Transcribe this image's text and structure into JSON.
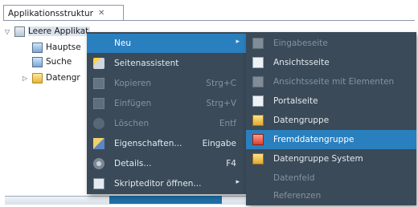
{
  "view": {
    "tab_label": "Applikationsstruktur",
    "tab_close": "✕"
  },
  "tree": {
    "items": [
      {
        "label": "Leere Applikat",
        "expanded": "▽"
      },
      {
        "label": "Hauptse"
      },
      {
        "label": "Suche"
      },
      {
        "label": "Datengr",
        "collapsed": "▷"
      }
    ]
  },
  "context_menu": {
    "items": [
      {
        "label": "Neu",
        "shortcut": "",
        "submenu": "▸",
        "highlighted": true
      },
      {
        "label": "Seitenassistent",
        "shortcut": ""
      },
      {
        "label": "Kopieren",
        "shortcut": "Strg+C",
        "disabled": true
      },
      {
        "label": "Einfügen",
        "shortcut": "Strg+V",
        "disabled": true
      },
      {
        "label": "Löschen",
        "shortcut": "Entf",
        "disabled": true
      },
      {
        "label": "Eigenschaften...",
        "shortcut": "Eingabe"
      },
      {
        "label": "Details...",
        "shortcut": "F4"
      },
      {
        "label": "Skripteditor öffnen...",
        "shortcut": "",
        "submenu": "▸"
      }
    ]
  },
  "submenu_new": {
    "items": [
      {
        "label": "Eingabeseite",
        "disabled": true
      },
      {
        "label": "Ansichtsseite"
      },
      {
        "label": "Ansichtsseite mit Elementen",
        "disabled": true
      },
      {
        "label": "Portalseite"
      },
      {
        "label": "Datengruppe"
      },
      {
        "label": "Fremddatengruppe",
        "highlighted": true
      },
      {
        "label": "Datengruppe System"
      },
      {
        "label": "Datenfeld",
        "disabled": true
      },
      {
        "label": "Referenzen",
        "disabled": true
      }
    ]
  },
  "colors": {
    "menu_bg": "#3a4a58",
    "highlight": "#2a7fbe",
    "menu_text": "#e4e9ee",
    "disabled_text": "#8593a0"
  }
}
